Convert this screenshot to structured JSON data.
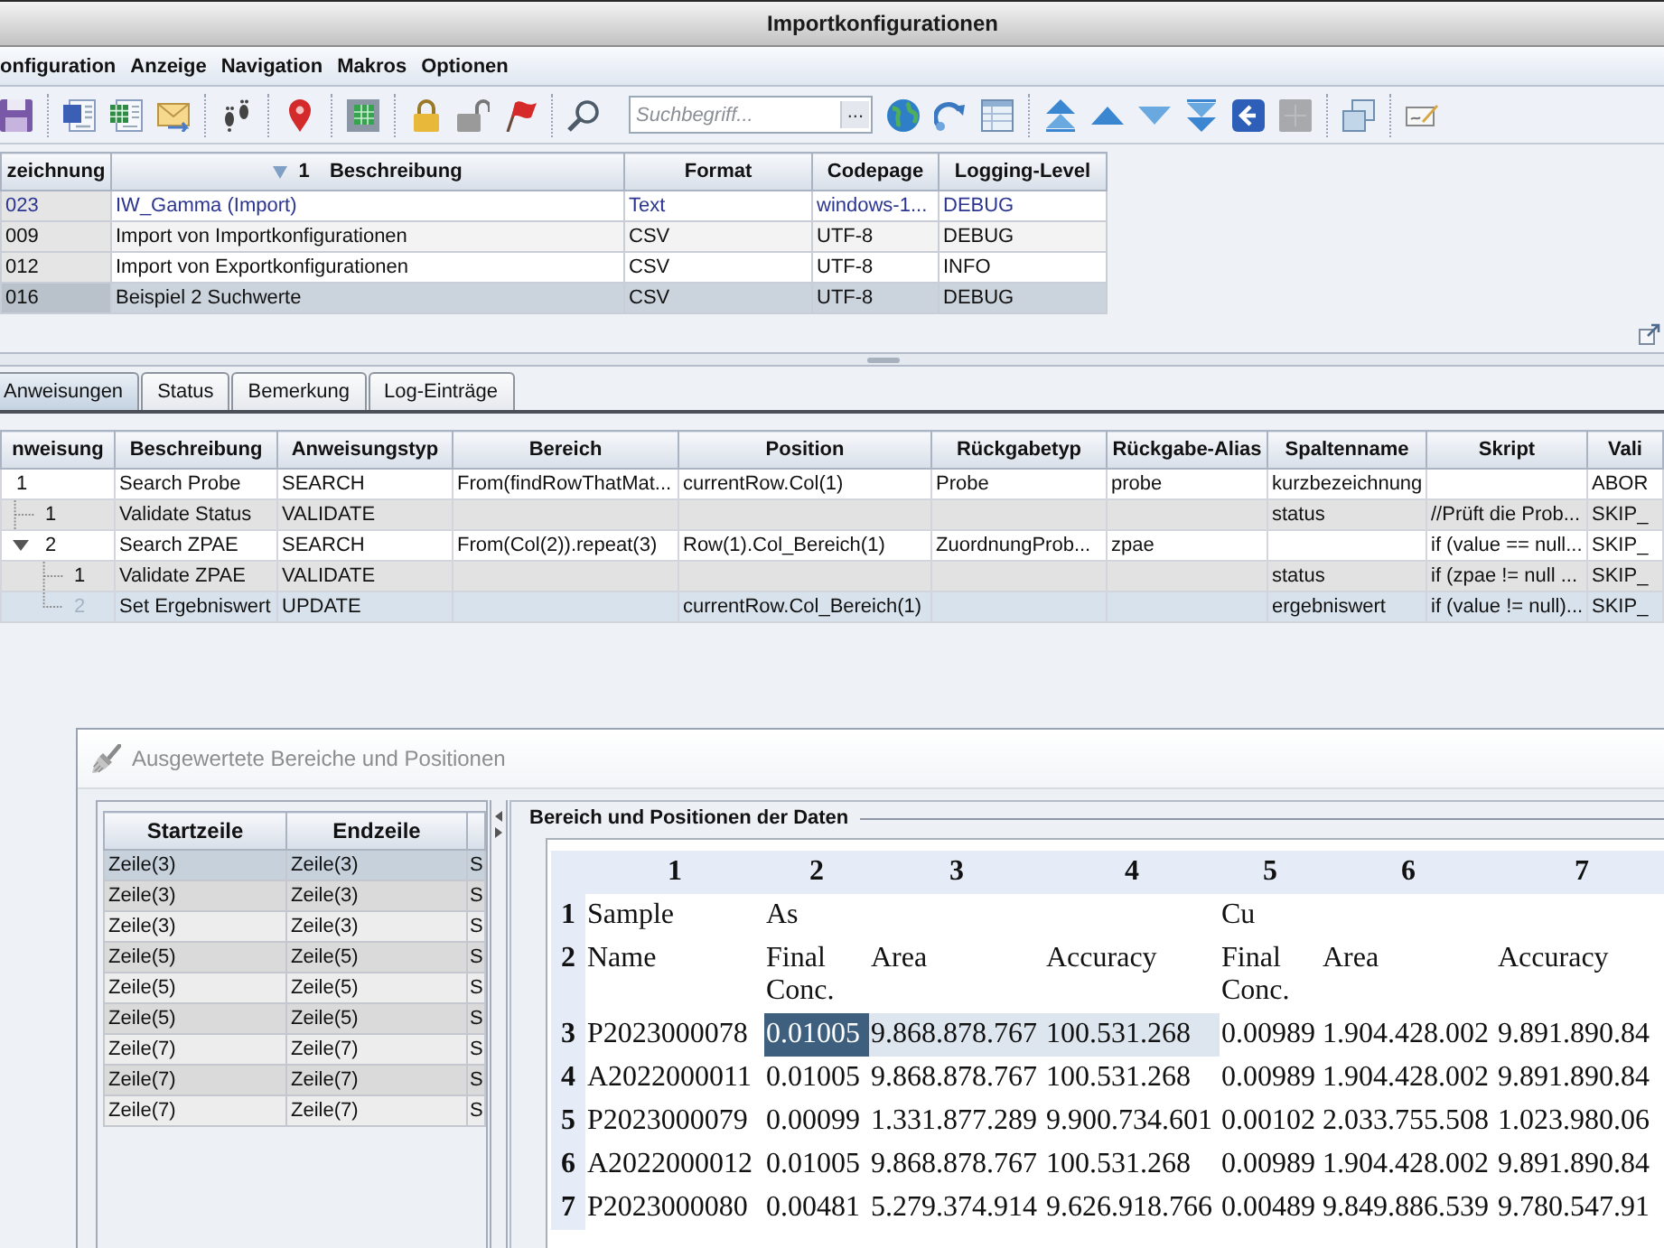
{
  "window": {
    "title": "Importkonfigurationen"
  },
  "menu": [
    "onfiguration",
    "Anzeige",
    "Navigation",
    "Makros",
    "Optionen"
  ],
  "search": {
    "placeholder": "Suchbegriff...",
    "button_label": "..."
  },
  "configurations": {
    "columns": [
      {
        "label": "zeichnung",
        "sorted": false
      },
      {
        "label": "Beschreibung",
        "sorted": true,
        "sort_order": "1"
      },
      {
        "label": "Format",
        "sorted": false
      },
      {
        "label": "Codepage",
        "sorted": false
      },
      {
        "label": "Logging-Level",
        "sorted": false
      }
    ],
    "rows": [
      {
        "cells": [
          "023",
          "IW_Gamma (Import)",
          "Text",
          "windows-1...",
          "DEBUG"
        ],
        "emphasized": true,
        "selected": false
      },
      {
        "cells": [
          "009",
          "Import von Importkonfigurationen",
          "CSV",
          "UTF-8",
          "DEBUG"
        ],
        "emphasized": false,
        "selected": false
      },
      {
        "cells": [
          "012",
          "Import von Exportkonfigurationen",
          "CSV",
          "UTF-8",
          "INFO"
        ],
        "emphasized": false,
        "selected": false
      },
      {
        "cells": [
          "016",
          "Beispiel 2 Suchwerte",
          "CSV",
          "UTF-8",
          "DEBUG"
        ],
        "emphasized": false,
        "selected": true
      }
    ]
  },
  "tabs": [
    {
      "label": "Anweisungen",
      "selected": true
    },
    {
      "label": "Status",
      "selected": false
    },
    {
      "label": "Bemerkung",
      "selected": false
    },
    {
      "label": "Log-Einträge",
      "selected": false
    }
  ],
  "instructions": {
    "columns": [
      "nweisung",
      "Beschreibung",
      "Anweisungstyp",
      "Bereich",
      "Position",
      "Rückgabetyp",
      "Rückgabe-Alias",
      "Spaltenname",
      "Skript",
      "Vali"
    ],
    "rows": [
      {
        "cells": [
          "1",
          "Search Probe",
          "SEARCH",
          "From(findRowThatMat...",
          "currentRow.Col(1)",
          "Probe",
          "probe",
          "kurzbezeichnung",
          null,
          "ABOR"
        ],
        "selected": false,
        "children": [
          {
            "cells": [
              "1",
              "Validate Status",
              "VALIDATE",
              null,
              null,
              null,
              null,
              "status",
              "//Prüft die Prob...",
              "SKIP_"
            ],
            "selected": false,
            "expanded": false
          },
          {
            "cells": [
              "2",
              "Search ZPAE",
              "SEARCH",
              "From(Col(2)).repeat(3)",
              "Row(1).Col_Bereich(1)",
              "ZuordnungProb...",
              "zpae",
              null,
              "if (value == null...",
              "SKIP_"
            ],
            "selected": false,
            "expanded": true,
            "children": [
              {
                "cells": [
                  "1",
                  "Validate ZPAE",
                  "VALIDATE",
                  null,
                  null,
                  null,
                  null,
                  "status",
                  "if (zpae != null ...",
                  "SKIP_"
                ],
                "selected": false,
                "expanded": false
              },
              {
                "cells": [
                  "2",
                  "Set Ergebniswert",
                  "UPDATE",
                  null,
                  "currentRow.Col_Bereich(1)",
                  null,
                  null,
                  "ergebniswert",
                  "if (value != null)...",
                  "SKIP_"
                ],
                "selected": true,
                "expanded": false
              }
            ]
          }
        ]
      }
    ]
  },
  "dialog": {
    "title": "Ausgewertete Bereiche und Positionen",
    "ranges": {
      "columns": [
        "Startzeile",
        "Endzeile"
      ],
      "rows": [
        {
          "cells": [
            "Zeile(3)",
            "Zeile(3)",
            "S"
          ],
          "selected": true
        },
        {
          "cells": [
            "Zeile(3)",
            "Zeile(3)",
            "S"
          ],
          "selected": false
        },
        {
          "cells": [
            "Zeile(3)",
            "Zeile(3)",
            "S"
          ],
          "selected": false
        },
        {
          "cells": [
            "Zeile(5)",
            "Zeile(5)",
            "S"
          ],
          "selected": false
        },
        {
          "cells": [
            "Zeile(5)",
            "Zeile(5)",
            "S"
          ],
          "selected": false
        },
        {
          "cells": [
            "Zeile(5)",
            "Zeile(5)",
            "S"
          ],
          "selected": false
        },
        {
          "cells": [
            "Zeile(7)",
            "Zeile(7)",
            "S"
          ],
          "selected": false
        },
        {
          "cells": [
            "Zeile(7)",
            "Zeile(7)",
            "S"
          ],
          "selected": false
        },
        {
          "cells": [
            "Zeile(7)",
            "Zeile(7)",
            "S"
          ],
          "selected": false
        }
      ]
    },
    "data": {
      "title": "Bereich und Positionen der Daten",
      "column_numbers": [
        "1",
        "2",
        "3",
        "4",
        "5",
        "6",
        "7"
      ],
      "rows": [
        {
          "label": "1",
          "cells": [
            {
              "text": "Sample",
              "selected": false,
              "focused": false
            },
            {
              "text": "As",
              "selected": false,
              "focused": false
            },
            {
              "selected": false,
              "focused": false
            },
            {
              "selected": false,
              "focused": false
            },
            {
              "text": "Cu",
              "selected": false,
              "focused": false
            },
            {
              "selected": false,
              "focused": false
            },
            {
              "selected": false,
              "focused": false
            }
          ]
        },
        {
          "label": "2",
          "cells": [
            {
              "text": "Name",
              "selected": false,
              "focused": false
            },
            {
              "text": "Final Conc.",
              "selected": false,
              "focused": false
            },
            {
              "text": "Area",
              "selected": false,
              "focused": false
            },
            {
              "text": "Accuracy",
              "selected": false,
              "focused": false
            },
            {
              "text": "Final Conc.",
              "selected": false,
              "focused": false
            },
            {
              "text": "Area",
              "selected": false,
              "focused": false
            },
            {
              "text": "Accuracy",
              "selected": false,
              "focused": false
            }
          ]
        },
        {
          "label": "3",
          "cells": [
            {
              "text": "P2023000078",
              "selected": false,
              "focused": false
            },
            {
              "text": "0.01005",
              "selected": true,
              "focused": true
            },
            {
              "text": "9.868.878.767",
              "selected": true,
              "focused": false
            },
            {
              "text": "100.531.268",
              "selected": true,
              "focused": false
            },
            {
              "text": "0.00989",
              "selected": false,
              "focused": false
            },
            {
              "text": "1.904.428.002",
              "selected": false,
              "focused": false
            },
            {
              "text": "9.891.890.84",
              "selected": false,
              "focused": false
            }
          ]
        },
        {
          "label": "4",
          "cells": [
            {
              "text": "A2022000011",
              "selected": false,
              "focused": false
            },
            {
              "text": "0.01005",
              "selected": false,
              "focused": false
            },
            {
              "text": "9.868.878.767",
              "selected": false,
              "focused": false
            },
            {
              "text": "100.531.268",
              "selected": false,
              "focused": false
            },
            {
              "text": "0.00989",
              "selected": false,
              "focused": false
            },
            {
              "text": "1.904.428.002",
              "selected": false,
              "focused": false
            },
            {
              "text": "9.891.890.84",
              "selected": false,
              "focused": false
            }
          ]
        },
        {
          "label": "5",
          "cells": [
            {
              "text": "P2023000079",
              "selected": false,
              "focused": false
            },
            {
              "text": "0.00099",
              "selected": false,
              "focused": false
            },
            {
              "text": "1.331.877.289",
              "selected": false,
              "focused": false
            },
            {
              "text": "9.900.734.601",
              "selected": false,
              "focused": false
            },
            {
              "text": "0.00102",
              "selected": false,
              "focused": false
            },
            {
              "text": "2.033.755.508",
              "selected": false,
              "focused": false
            },
            {
              "text": "1.023.980.06",
              "selected": false,
              "focused": false
            }
          ]
        },
        {
          "label": "6",
          "cells": [
            {
              "text": "A2022000012",
              "selected": false,
              "focused": false
            },
            {
              "text": "0.01005",
              "selected": false,
              "focused": false
            },
            {
              "text": "9.868.878.767",
              "selected": false,
              "focused": false
            },
            {
              "text": "100.531.268",
              "selected": false,
              "focused": false
            },
            {
              "text": "0.00989",
              "selected": false,
              "focused": false
            },
            {
              "text": "1.904.428.002",
              "selected": false,
              "focused": false
            },
            {
              "text": "9.891.890.84",
              "selected": false,
              "focused": false
            }
          ]
        },
        {
          "label": "7",
          "cells": [
            {
              "text": "P2023000080",
              "selected": false,
              "focused": false
            },
            {
              "text": "0.00481",
              "selected": false,
              "focused": false
            },
            {
              "text": "5.279.374.914",
              "selected": false,
              "focused": false
            },
            {
              "text": "9.626.918.766",
              "selected": false,
              "focused": false
            },
            {
              "text": "0.00489",
              "selected": false,
              "focused": false
            },
            {
              "text": "9.849.886.539",
              "selected": false,
              "focused": false
            },
            {
              "text": "9.780.547.91",
              "selected": false,
              "focused": false
            }
          ]
        }
      ]
    }
  }
}
